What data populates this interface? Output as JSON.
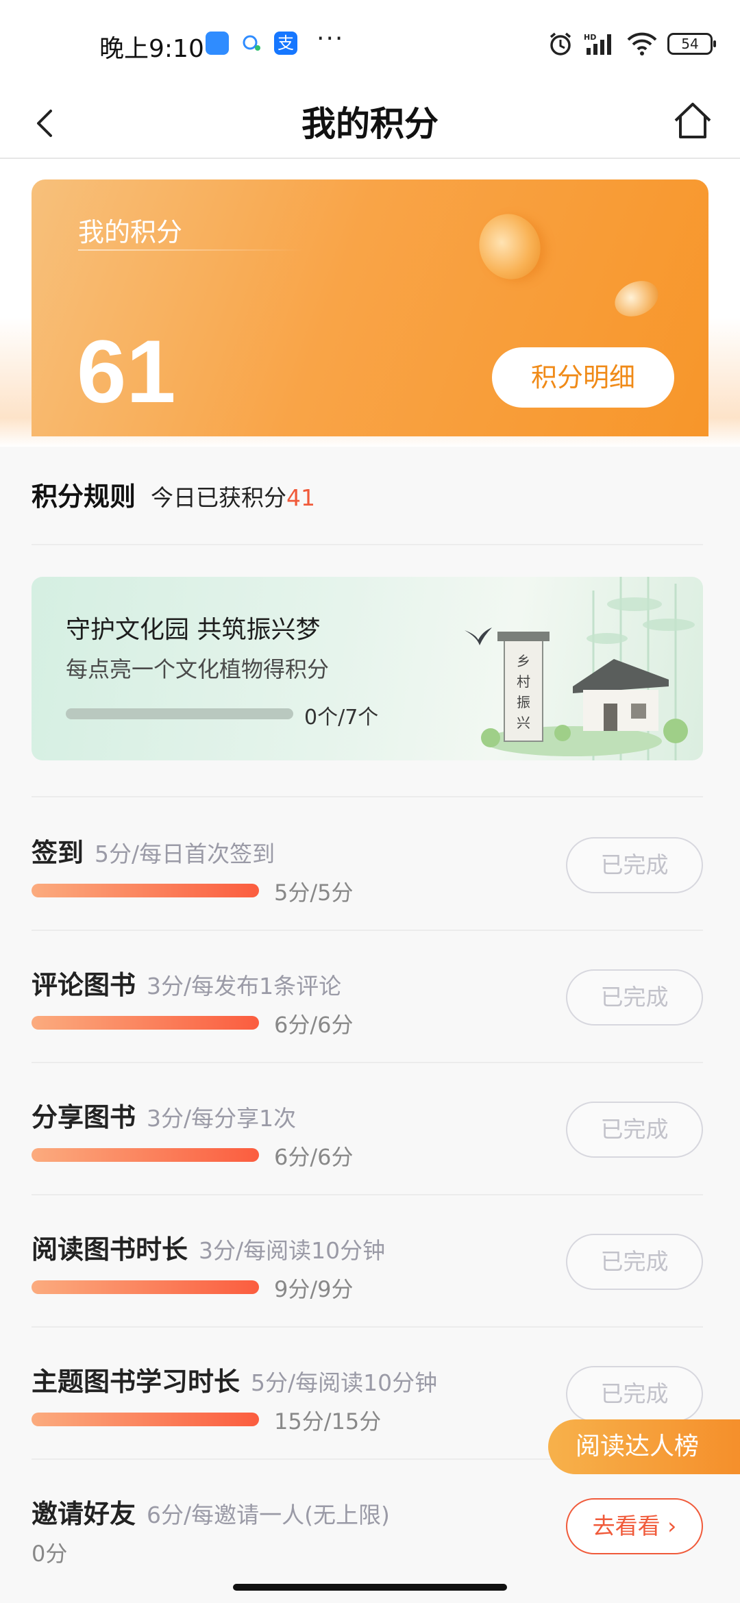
{
  "status_bar": {
    "time": "晚上9:10",
    "battery": "54"
  },
  "nav": {
    "title": "我的积分"
  },
  "points_card": {
    "label": "我的积分",
    "value": "61",
    "detail_button": "积分明细"
  },
  "rules": {
    "title": "积分规则",
    "today_prefix": "今日已获积分",
    "today_value": "41"
  },
  "banner": {
    "title": "守护文化园 共筑振兴梦",
    "subtitle": "每点亮一个文化植物得积分",
    "progress_text": "0个/7个",
    "progress_fraction": 0
  },
  "tasks": [
    {
      "name": "签到",
      "desc": "5分/每日首次签到",
      "progress": "5分/5分",
      "button": "已完成"
    },
    {
      "name": "评论图书",
      "desc": "3分/每发布1条评论",
      "progress": "6分/6分",
      "button": "已完成"
    },
    {
      "name": "分享图书",
      "desc": "3分/每分享1次",
      "progress": "6分/6分",
      "button": "已完成"
    },
    {
      "name": "阅读图书时长",
      "desc": "3分/每阅读10分钟",
      "progress": "9分/9分",
      "button": "已完成"
    },
    {
      "name": "主题图书学习时长",
      "desc": "5分/每阅读10分钟",
      "progress": "15分/15分",
      "button": "已完成"
    },
    {
      "name": "邀请好友",
      "desc": "6分/每邀请一人(无上限)",
      "progress": "0分",
      "button": "去看看"
    }
  ],
  "floating": {
    "rank_label": "阅读达人榜"
  },
  "colors": {
    "accent_orange": "#f7962a",
    "accent_red": "#f05a3a"
  }
}
